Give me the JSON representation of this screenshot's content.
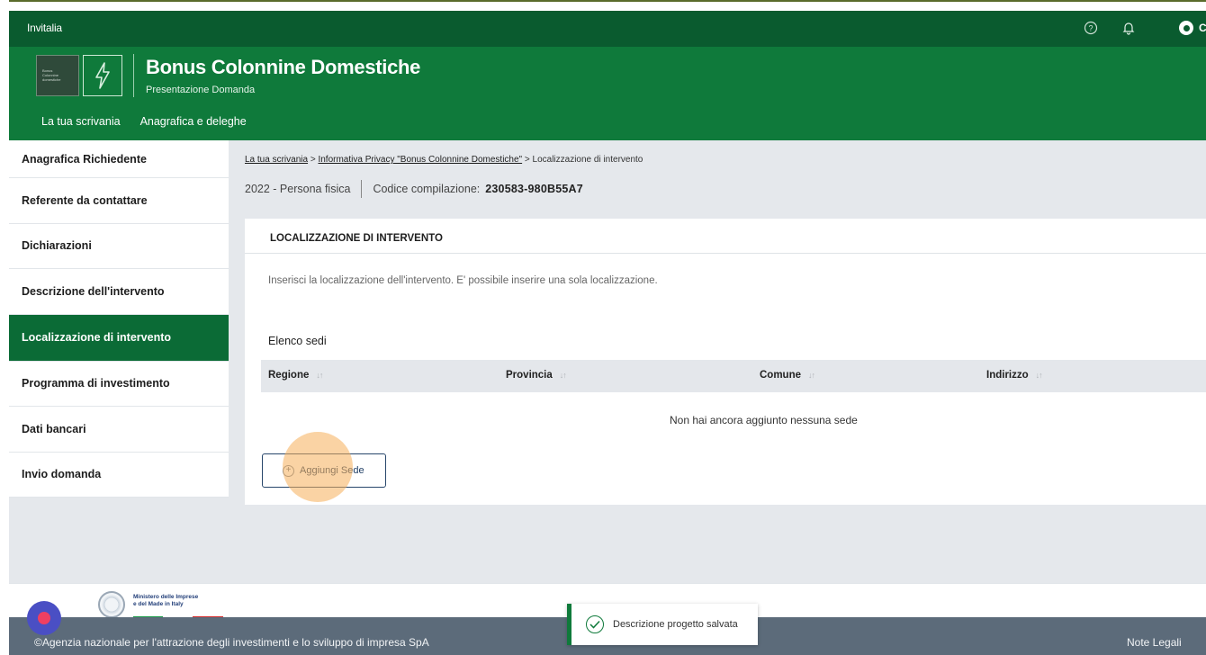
{
  "topbar": {
    "brand": "Invitalia",
    "help_icon": "question-circle-icon",
    "bell_icon": "bell-icon",
    "user_name": "Cla"
  },
  "header": {
    "logo_lines": [
      "Bonus",
      "Colonnine",
      "domestiche"
    ],
    "title": "Bonus Colonnine Domestiche",
    "subtitle": "Presentazione Domanda",
    "nav": [
      "La tua scrivania",
      "Anagrafica e deleghe"
    ]
  },
  "sidebar": {
    "items": [
      "Anagrafica Richiedente",
      "Referente da contattare",
      "Dichiarazioni",
      "Descrizione dell'intervento",
      "Localizzazione di intervento",
      "Programma di investimento",
      "Dati bancari",
      "Invio domanda"
    ],
    "active_index": 4
  },
  "breadcrumb": {
    "items": [
      "La tua scrivania",
      "Informativa Privacy \"Bonus Colonnine Domestiche\"",
      "Localizzazione di intervento"
    ],
    "separator": ">"
  },
  "meta": {
    "year_type": "2022 - Persona fisica",
    "code_label": "Codice compilazione:",
    "code_value": "230583-980B55A7"
  },
  "section": {
    "title": "LOCALIZZAZIONE DI INTERVENTO",
    "info": "Inserisci la localizzazione dell'intervento. E' possibile inserire una sola localizzazione.",
    "list_label": "Elenco sedi",
    "columns": [
      "Regione",
      "Provincia",
      "Comune",
      "Indirizzo"
    ],
    "sort_glyph": "↓↑",
    "empty_message": "Non hai ancora aggiunto nessuna sede",
    "add_button": "Aggiungi Sede"
  },
  "footer": {
    "ministry_lines": [
      "Ministero delle Imprese",
      "e del Made in Italy"
    ],
    "copyright": "©Agenzia nazionale per l'attrazione degli investimenti e lo sviluppo di impresa SpA",
    "legal": "Note Legali"
  },
  "toast": {
    "message": "Descrizione progetto salvata"
  },
  "colors": {
    "header_green": "#0f7a3b",
    "topbar_green": "#0a5b2f",
    "active_item": "#0b6b36",
    "footer_bar": "#5c6b7a",
    "button_border": "#27466b"
  }
}
